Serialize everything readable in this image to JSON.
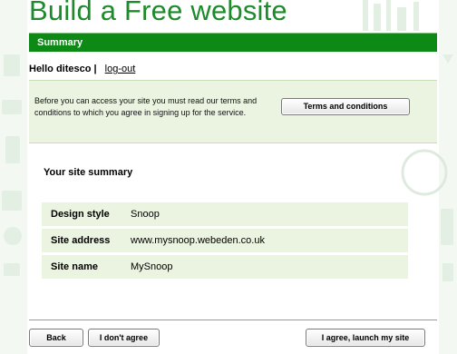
{
  "header": {
    "title": "Build a Free website",
    "section_label": "Summary"
  },
  "user": {
    "greeting": "Hello ditesco |",
    "logout_label": "log-out"
  },
  "terms": {
    "notice": "Before you can access your site you must read our terms and conditions to which you agree in signing up for the service.",
    "button_label": "Terms and conditions"
  },
  "summary": {
    "heading": "Your site summary",
    "rows": [
      {
        "label": "Design style",
        "value": "Snoop"
      },
      {
        "label": "Site address",
        "value": "www.mysnoop.webeden.co.uk"
      },
      {
        "label": "Site name",
        "value": "MySnoop"
      }
    ]
  },
  "footer": {
    "back_label": "Back",
    "dont_agree_label": "I don't agree",
    "launch_label": "I agree, launch my site"
  },
  "colors": {
    "brand_green": "#1d8a2b",
    "bar_green": "#0d8a16",
    "panel_bg": "#ebf4e1"
  }
}
